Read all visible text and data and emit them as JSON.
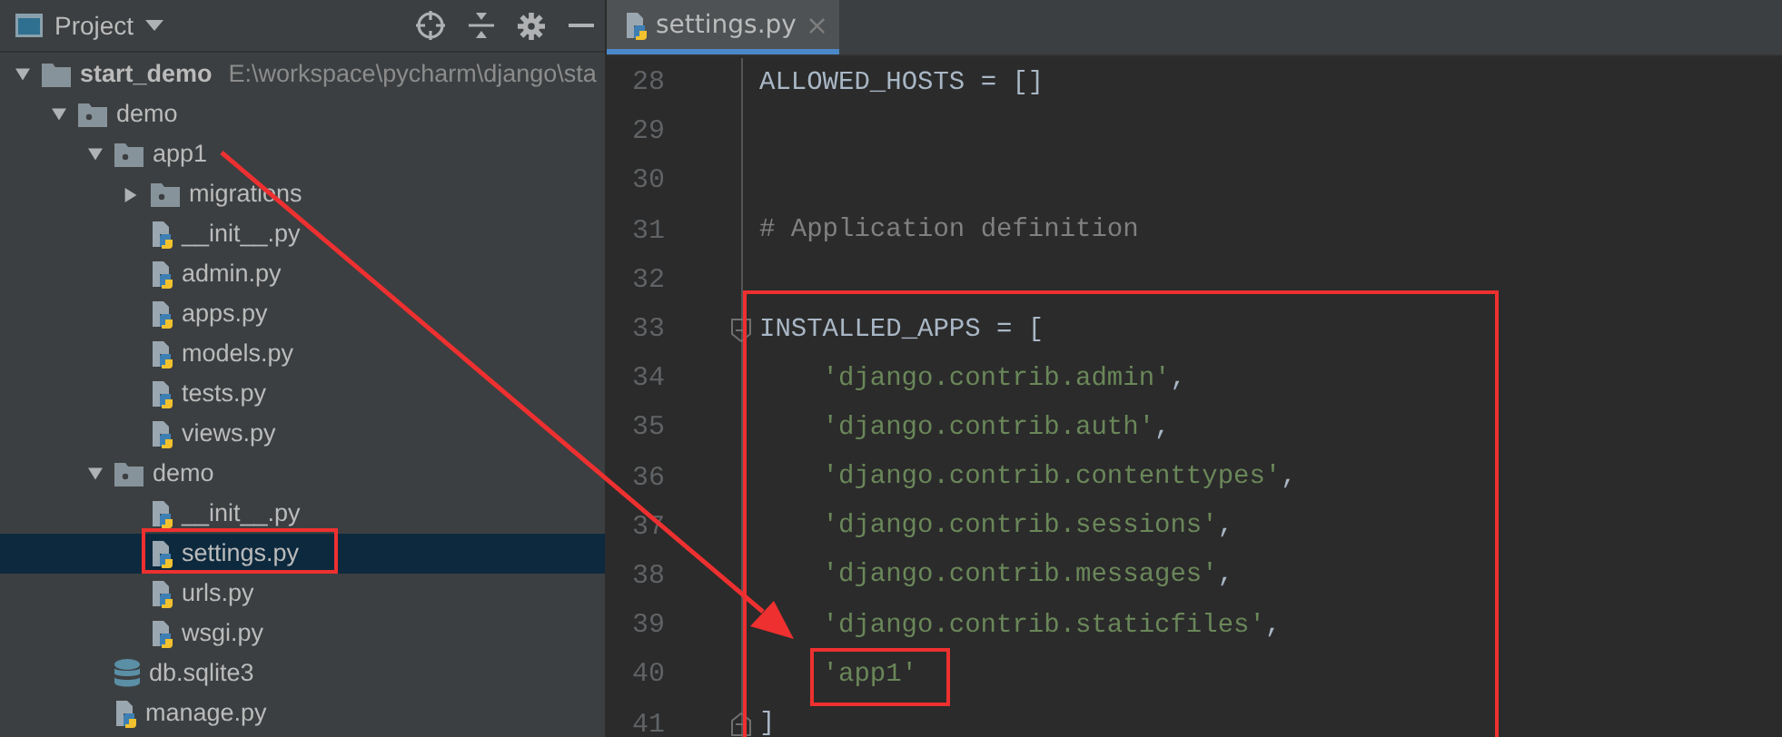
{
  "project_panel": {
    "title": "Project",
    "tree": [
      {
        "kind": "project",
        "label": "start_demo",
        "path": "E:\\workspace\\pycharm\\django\\sta",
        "expanded": true,
        "selected": false,
        "children": [
          {
            "kind": "package",
            "label": "demo",
            "expanded": true,
            "selected": false,
            "children": [
              {
                "kind": "package",
                "label": "app1",
                "expanded": true,
                "selected": false,
                "children": [
                  {
                    "kind": "package",
                    "label": "migrations",
                    "expanded": false,
                    "selected": false
                  },
                  {
                    "kind": "python",
                    "label": "__init__.py",
                    "selected": false
                  },
                  {
                    "kind": "python",
                    "label": "admin.py",
                    "selected": false
                  },
                  {
                    "kind": "python",
                    "label": "apps.py",
                    "selected": false
                  },
                  {
                    "kind": "python",
                    "label": "models.py",
                    "selected": false
                  },
                  {
                    "kind": "python",
                    "label": "tests.py",
                    "selected": false
                  },
                  {
                    "kind": "python",
                    "label": "views.py",
                    "selected": false
                  }
                ]
              },
              {
                "kind": "package",
                "label": "demo",
                "expanded": true,
                "selected": false,
                "children": [
                  {
                    "kind": "python",
                    "label": "__init__.py",
                    "selected": false
                  },
                  {
                    "kind": "python",
                    "label": "settings.py",
                    "selected": true
                  },
                  {
                    "kind": "python",
                    "label": "urls.py",
                    "selected": false
                  },
                  {
                    "kind": "python",
                    "label": "wsgi.py",
                    "selected": false
                  }
                ]
              },
              {
                "kind": "database",
                "label": "db.sqlite3",
                "selected": false
              },
              {
                "kind": "python",
                "label": "manage.py",
                "selected": false
              }
            ]
          }
        ]
      }
    ]
  },
  "editor": {
    "tabs": [
      {
        "label": "settings.py",
        "close": "×",
        "selected": true
      }
    ],
    "lines": [
      {
        "number": "28",
        "kind": "code",
        "tokens": [
          {
            "kind": "plain",
            "text": "ALLOWED_HOSTS = []"
          }
        ]
      },
      {
        "number": "29",
        "kind": "code"
      },
      {
        "number": "30",
        "kind": "code"
      },
      {
        "number": "31",
        "kind": "code",
        "tokens": [
          {
            "kind": "comment",
            "text": "# Application definition"
          }
        ]
      },
      {
        "number": "32",
        "kind": "code"
      },
      {
        "number": "33",
        "kind": "fold_start",
        "tokens": [
          {
            "kind": "plain",
            "text": "INSTALLED_APPS = ["
          }
        ]
      },
      {
        "number": "34",
        "kind": "code",
        "indent": true,
        "tokens": [
          {
            "kind": "string",
            "text": "'django.contrib.admin'"
          },
          {
            "kind": "plain",
            "text": ","
          }
        ]
      },
      {
        "number": "35",
        "kind": "code",
        "indent": true,
        "tokens": [
          {
            "kind": "string",
            "text": "'django.contrib.auth'"
          },
          {
            "kind": "plain",
            "text": ","
          }
        ]
      },
      {
        "number": "36",
        "kind": "code",
        "indent": true,
        "tokens": [
          {
            "kind": "string",
            "text": "'django.contrib.contenttypes'"
          },
          {
            "kind": "plain",
            "text": ","
          }
        ]
      },
      {
        "number": "37",
        "kind": "code",
        "indent": true,
        "tokens": [
          {
            "kind": "string",
            "text": "'django.contrib.sessions'"
          },
          {
            "kind": "plain",
            "text": ","
          }
        ]
      },
      {
        "number": "38",
        "kind": "code",
        "indent": true,
        "tokens": [
          {
            "kind": "string",
            "text": "'django.contrib.messages'"
          },
          {
            "kind": "plain",
            "text": ","
          }
        ]
      },
      {
        "number": "39",
        "kind": "code",
        "indent": true,
        "tokens": [
          {
            "kind": "string",
            "text": "'django.contrib.staticfiles'"
          },
          {
            "kind": "plain",
            "text": ","
          }
        ]
      },
      {
        "number": "40",
        "kind": "code",
        "indent": true,
        "tokens": [
          {
            "kind": "string",
            "text": "'app1'"
          }
        ]
      },
      {
        "number": "41",
        "kind": "fold_end",
        "tokens": [
          {
            "kind": "plain",
            "text": "]"
          }
        ]
      }
    ]
  }
}
